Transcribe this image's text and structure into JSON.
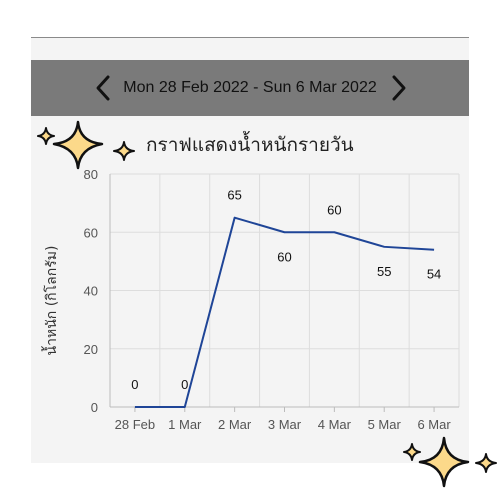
{
  "header": {
    "date_range": "Mon 28 Feb 2022 - Sun 6 Mar 2022",
    "prev_icon": "chevron-left-icon",
    "next_icon": "chevron-right-icon"
  },
  "colors": {
    "header_bg": "#7a7a7a",
    "line": "#1f4597",
    "grid": "#dddddd",
    "sparkle_fill": "#fcd98a"
  },
  "chart_data": {
    "type": "line",
    "title": "กราฟแสดงน้ำหนักรายวัน",
    "ylabel": "น้ำหนัก (กิโลกรัม)",
    "xlabel": "",
    "categories": [
      "28 Feb",
      "1 Mar",
      "2 Mar",
      "3 Mar",
      "4 Mar",
      "5 Mar",
      "6 Mar"
    ],
    "values": [
      0,
      0,
      65,
      60,
      60,
      55,
      54
    ],
    "data_labels": [
      "0",
      "0",
      "65",
      "60",
      "60",
      "55",
      "54"
    ],
    "ylim": [
      0,
      80
    ],
    "yticks": [
      0,
      20,
      40,
      60,
      80
    ],
    "grid": true,
    "legend": "none"
  }
}
